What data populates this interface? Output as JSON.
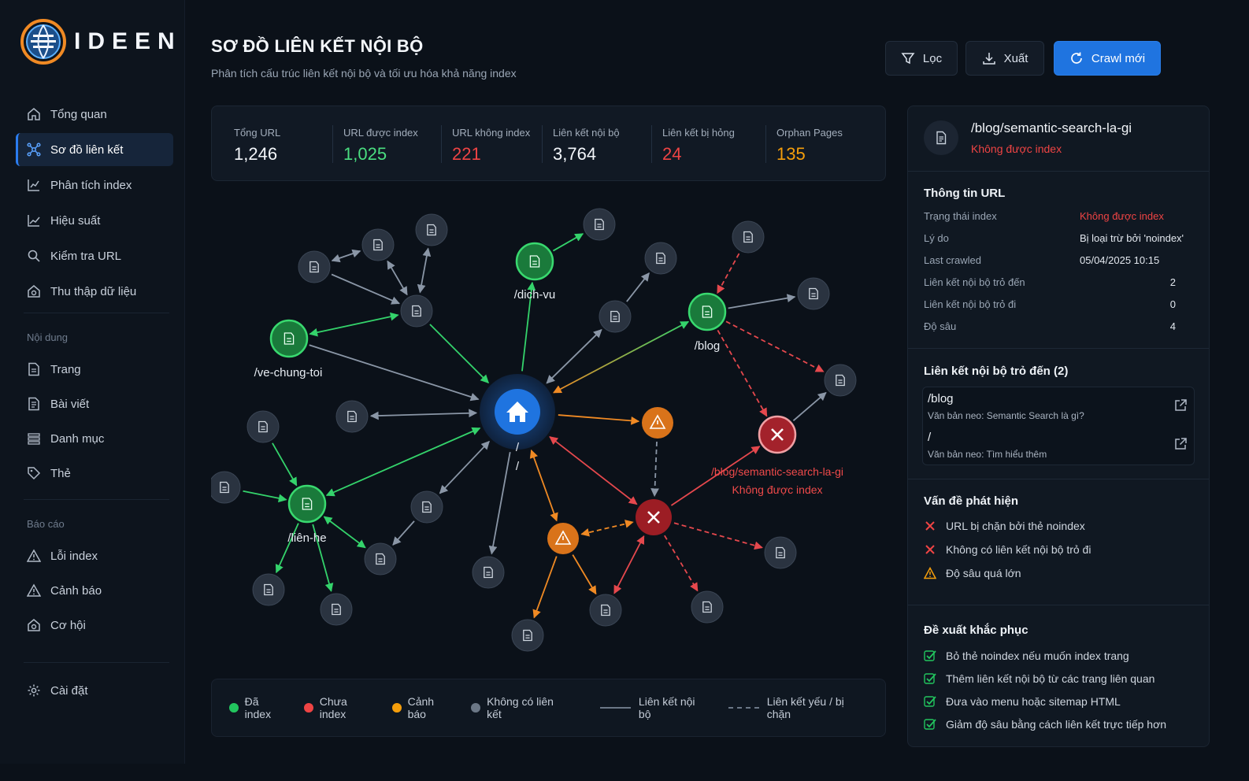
{
  "app": {
    "logo_text": "IDEEN"
  },
  "sidebar": {
    "items": [
      {
        "label": "Tổng quan",
        "icon": "home-icon"
      },
      {
        "label": "Sơ đồ liên kết",
        "icon": "network-icon",
        "active": true
      },
      {
        "label": "Phân tích index",
        "icon": "chart-scan-icon"
      },
      {
        "label": "Hiệu suất",
        "icon": "line-chart-icon"
      },
      {
        "label": "Kiểm tra URL",
        "icon": "search-icon"
      },
      {
        "label": "Thu thập dữ liệu",
        "icon": "crawler-icon"
      }
    ],
    "section_content": "Nội dung",
    "content_items": [
      {
        "label": "Trang",
        "icon": "page-icon"
      },
      {
        "label": "Bài viết",
        "icon": "article-icon"
      },
      {
        "label": "Danh mục",
        "icon": "list-icon"
      },
      {
        "label": "Thẻ",
        "icon": "tag-icon"
      }
    ],
    "section_reports": "Báo cáo",
    "report_items": [
      {
        "label": "Lỗi index",
        "icon": "warning-icon"
      },
      {
        "label": "Cảnh báo",
        "icon": "alert-icon"
      },
      {
        "label": "Cơ hội",
        "icon": "opportunity-icon"
      }
    ],
    "settings": {
      "label": "Cài đặt",
      "icon": "gear-icon"
    }
  },
  "header": {
    "title": "SƠ ĐỒ LIÊN KẾT NỘI BỘ",
    "subtitle": "Phân tích cấu trúc liên kết nội bộ và tối ưu hóa khả năng index",
    "filter_label": "Lọc",
    "export_label": "Xuất",
    "crawl_label": "Crawl mới"
  },
  "stats": [
    {
      "label": "Tổng URL",
      "value": "1,246",
      "color": "#f3f6fa"
    },
    {
      "label": "URL được index",
      "value": "1,025",
      "color": "#4ade80"
    },
    {
      "label": "URL không index",
      "value": "221",
      "color": "#ef4444"
    },
    {
      "label": "Liên kết nội bộ",
      "value": "3,764",
      "color": "#f3f6fa"
    },
    {
      "label": "Liên kết bị hỏng",
      "value": "24",
      "color": "#ef4444"
    },
    {
      "label": "Orphan Pages",
      "value": "135",
      "color": "#f59e0b"
    }
  ],
  "graph": {
    "labels": {
      "home": "/",
      "dich_vu": "/dich-vu",
      "blog": "/blog",
      "ve_chung_toi": "/ve-chung-toi",
      "lien_he": "/liên-he",
      "semantic": "/blog/semantic-search-la-gi",
      "semantic_status": "Không được index"
    },
    "colors": {
      "indexed": "#22c55e",
      "not_indexed": "#ef4444",
      "warning": "#f59e0b",
      "no_link": "#6b7786",
      "home": "#1f74e0"
    }
  },
  "legend": {
    "indexed": "Đã index",
    "not_indexed": "Chưa index",
    "warning": "Cảnh báo",
    "no_link": "Không có liên kết",
    "internal": "Liên kết nội bộ",
    "weak": "Liên kết yếu / bị chặn"
  },
  "panel": {
    "url": "/blog/semantic-search-la-gi",
    "status": "Không được index",
    "info_title": "Thông tin URL",
    "info": [
      {
        "key": "Trạng thái index",
        "value": "Không được index"
      },
      {
        "key": "Lý do",
        "value": "Bị loại trừ bởi 'noindex'"
      },
      {
        "key": "Last crawled",
        "value": "05/04/2025 10:15"
      },
      {
        "key": "Liên kết nội bộ trỏ đến",
        "value": "2"
      },
      {
        "key": "Liên kết nội bộ trỏ đi",
        "value": "0"
      },
      {
        "key": "Độ sâu",
        "value": "4"
      }
    ],
    "inbound_title": "Liên kết nội bộ trỏ đến (2)",
    "inbound": [
      {
        "url": "/blog",
        "anchor": "Văn bản neo: Semantic Search là gì?"
      },
      {
        "url": "/",
        "anchor": "Văn bản neo: Tìm hiểu thêm"
      }
    ],
    "issues_title": "Vấn đề phát hiện",
    "issues": [
      {
        "text": "URL bị chặn bởi thẻ noindex",
        "type": "error"
      },
      {
        "text": "Không có liên kết nội bộ trỏ đi",
        "type": "error"
      },
      {
        "text": "Độ sâu quá lớn",
        "type": "warning"
      }
    ],
    "fixes_title": "Đề xuất khắc phục",
    "fixes": [
      "Bỏ thẻ noindex nếu muốn index trang",
      "Thêm liên kết nội bộ từ các trang liên quan",
      "Đưa vào menu hoặc sitemap HTML",
      "Giảm độ sâu bằng cách liên kết trực tiếp hơn"
    ]
  }
}
